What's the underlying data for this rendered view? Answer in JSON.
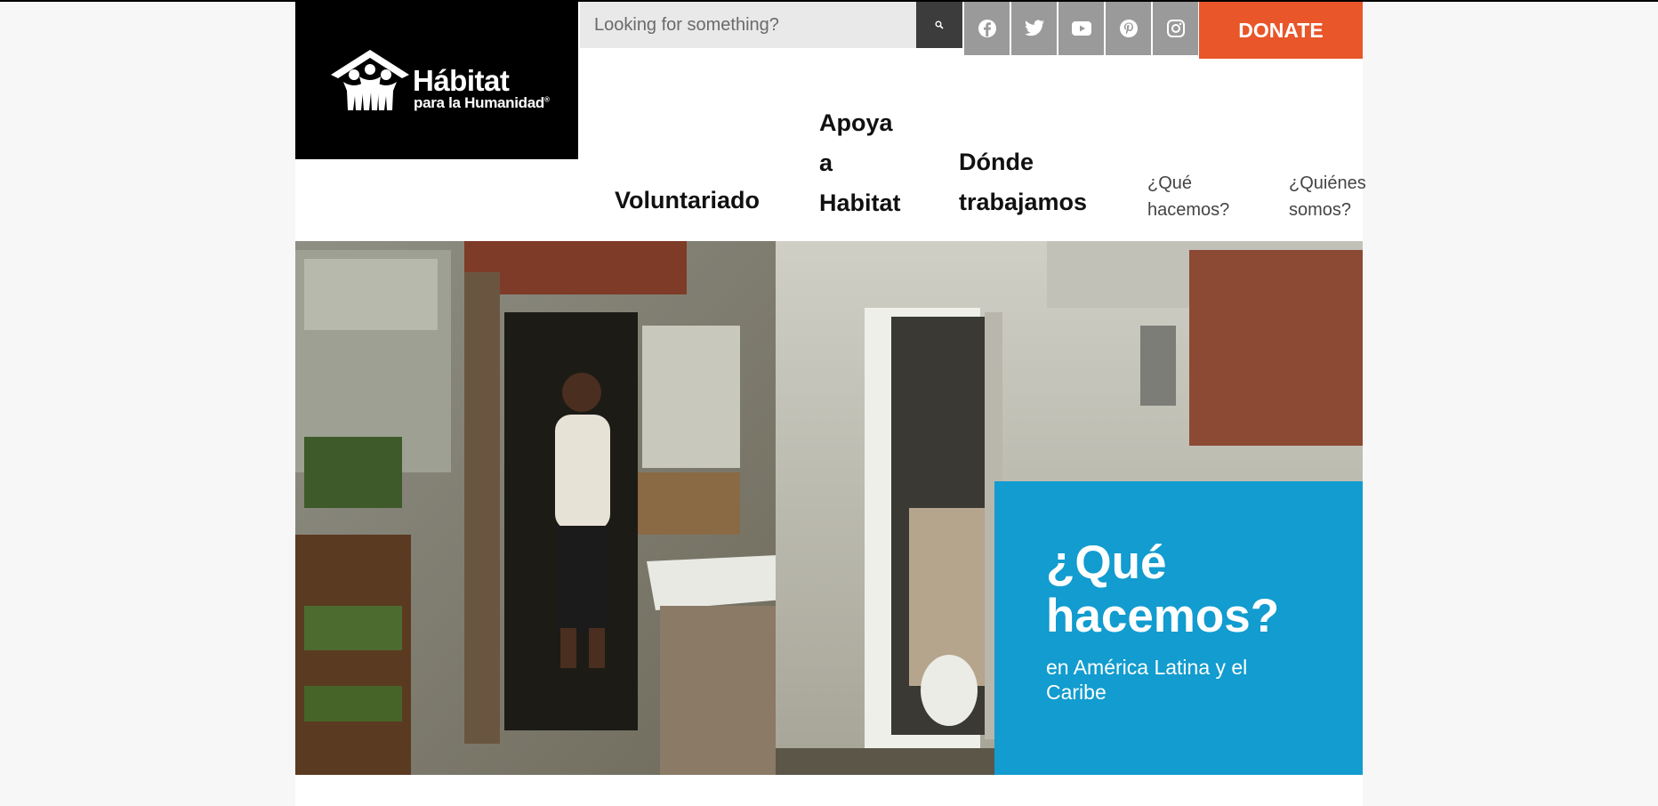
{
  "logo": {
    "name": "Hábitat",
    "subtitle": "para la Humanidad",
    "mark": "®"
  },
  "search": {
    "placeholder": "Looking for something?",
    "icon": "search-icon"
  },
  "social": [
    {
      "name": "facebook-icon"
    },
    {
      "name": "twitter-icon"
    },
    {
      "name": "youtube-icon"
    },
    {
      "name": "pinterest-icon"
    },
    {
      "name": "instagram-icon"
    }
  ],
  "donate": {
    "label": "DONATE",
    "color": "#e8562a"
  },
  "nav": {
    "voluntariado": {
      "line1": "Voluntariado"
    },
    "apoya": {
      "line1": "Apoya",
      "line2": "a",
      "line3": "Habitat"
    },
    "donde": {
      "line1": "Dónde",
      "line2": "trabajamos"
    },
    "que": {
      "line1": "¿Qué",
      "line2": "hacemos?"
    },
    "quienes": {
      "line1": "¿Quiénes",
      "line2": "somos?"
    }
  },
  "hero": {
    "title_line1": "¿Qué",
    "title_line2": "hacemos?",
    "subtitle": "en América Latina y el Caribe",
    "accent": "#129ccf"
  }
}
